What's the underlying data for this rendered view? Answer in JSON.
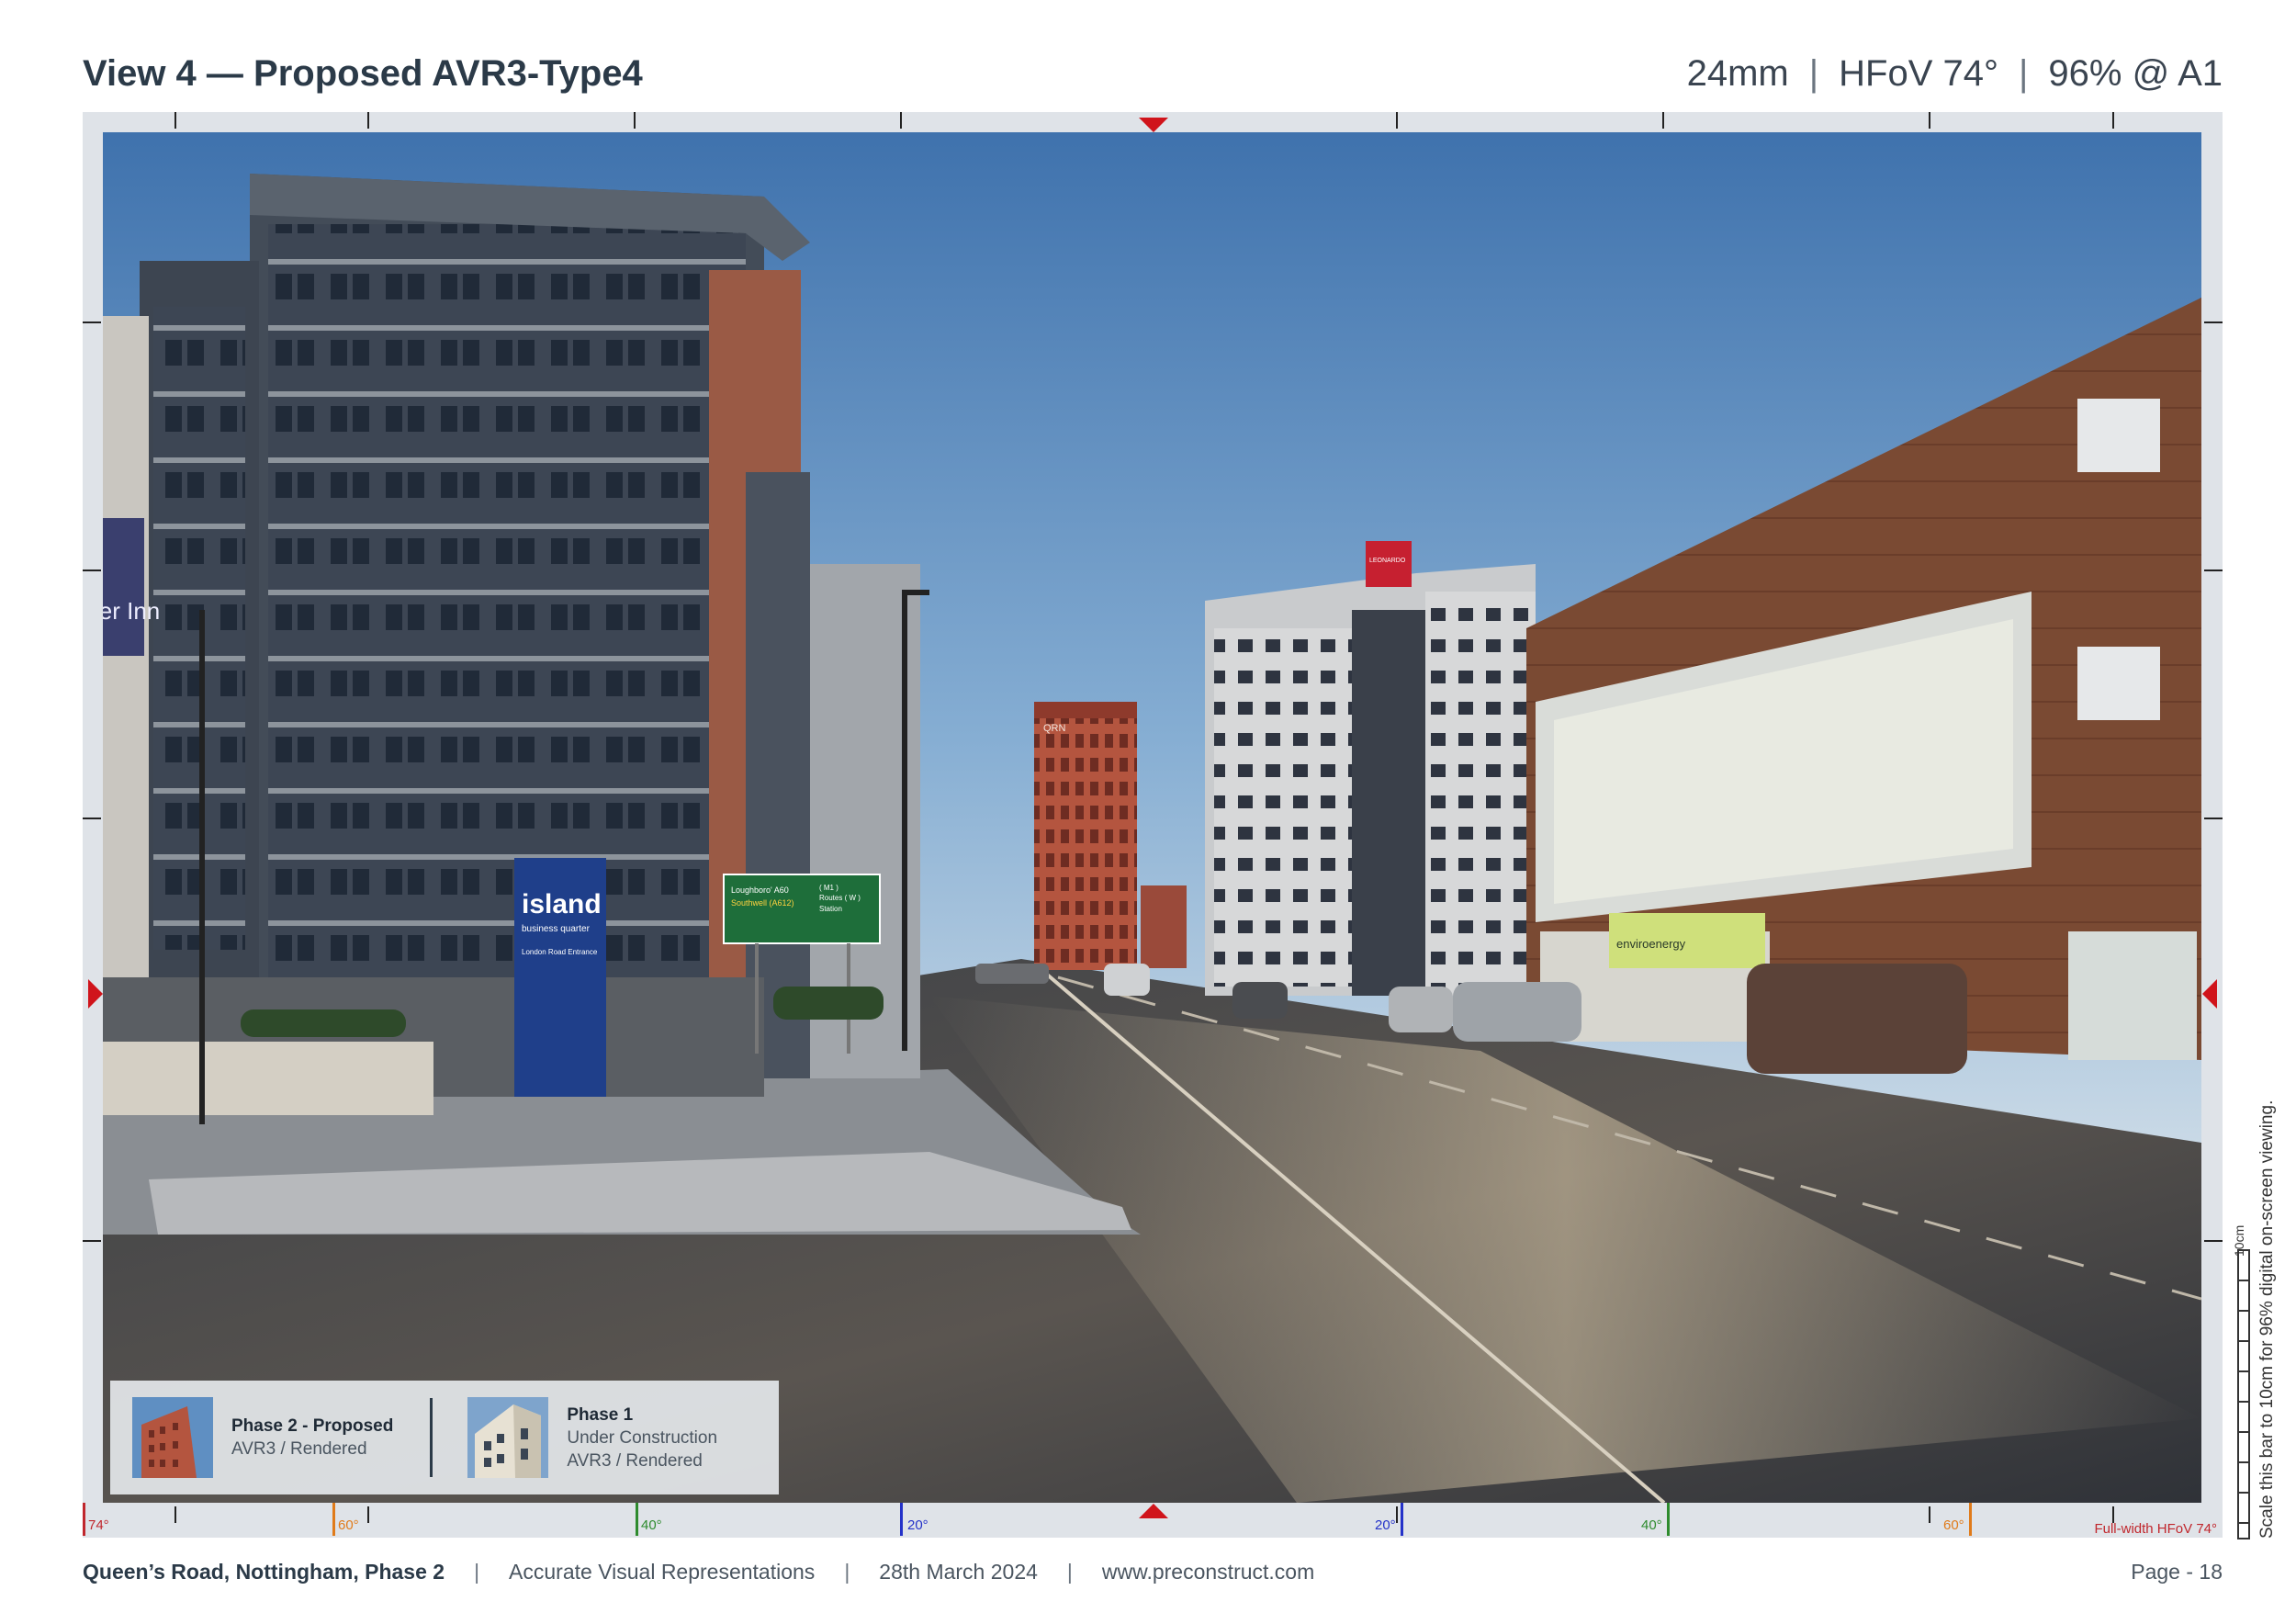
{
  "header": {
    "title": "View 4 — Proposed AVR3-Type4",
    "lens": "24mm",
    "hfov": "HFoV 74°",
    "scale": "96% @ A1"
  },
  "ruler": {
    "degrees": [
      "74°",
      "60°",
      "40°",
      "20°",
      "20°",
      "40°",
      "60°"
    ],
    "hfov_label": "Full-width HFoV 74°"
  },
  "photo_signs": {
    "island": "island",
    "island_sub": "business quarter",
    "island_entrance": "London Road Entrance",
    "road_sign_left1": "Loughboro' A60",
    "road_sign_left2": "Southwell (A612)",
    "road_sign_right1": "( M1 )",
    "road_sign_right2": "Routes ( W )",
    "road_sign_right3": "Station",
    "hotel_left": "ier Inn",
    "leonardo": "LEONARDO",
    "tower_letters": "QRN",
    "enviro": "enviroenergy"
  },
  "legend": {
    "phase2_title": "Phase 2 - Proposed",
    "phase2_sub": "AVR3 / Rendered",
    "phase1_title": "Phase 1",
    "phase1_sub1": "Under Construction",
    "phase1_sub2": "AVR3 / Rendered"
  },
  "side": {
    "note": "Scale this bar to 10cm for 96% digital on-screen viewing.",
    "scale_label": "10cm"
  },
  "footer": {
    "project": "Queen’s Road, Nottingham, Phase 2",
    "doc": "Accurate Visual Representations",
    "date": "28th March 2024",
    "url": "www.preconstruct.com",
    "page": "Page - 18"
  },
  "colors": {
    "accent_red": "#d0141b",
    "title_navy": "#2b3a48",
    "deg_74": "#c0272d",
    "deg_60": "#e07b1a",
    "deg_40": "#2e8b2e",
    "deg_20": "#2432c9"
  }
}
